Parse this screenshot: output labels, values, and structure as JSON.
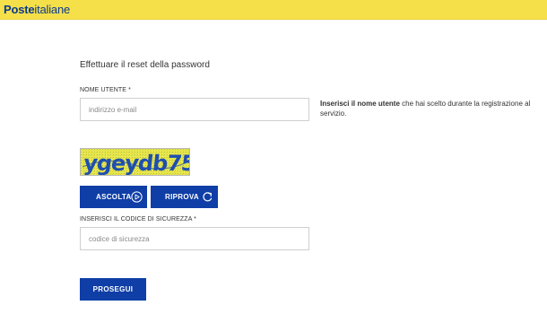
{
  "header": {
    "logo_bold": "Poste",
    "logo_light": "italiane",
    "bar_color": "#f5e04a",
    "brand_color": "#0b3a8c"
  },
  "form": {
    "title": "Effettuare il reset della password",
    "username_label": "NOME UTENTE *",
    "username_placeholder": "indirizzo e-mail",
    "username_value": "",
    "hint_bold": "Inserisci il nome utente",
    "hint_rest": " che hai scelto durante la registrazione al servizio.",
    "captcha_text": "ygeydb75",
    "listen_label": "ASCOLTA",
    "retry_label": "RIPROVA",
    "code_label": "INSERISCI IL CODICE DI SICUREZZA *",
    "code_placeholder": "codice di sicurezza",
    "code_value": "",
    "submit_label": "PROSEGUI",
    "button_color": "#0f3ea6"
  },
  "icons": {
    "listen": "play-circle-icon",
    "retry": "refresh-icon"
  }
}
